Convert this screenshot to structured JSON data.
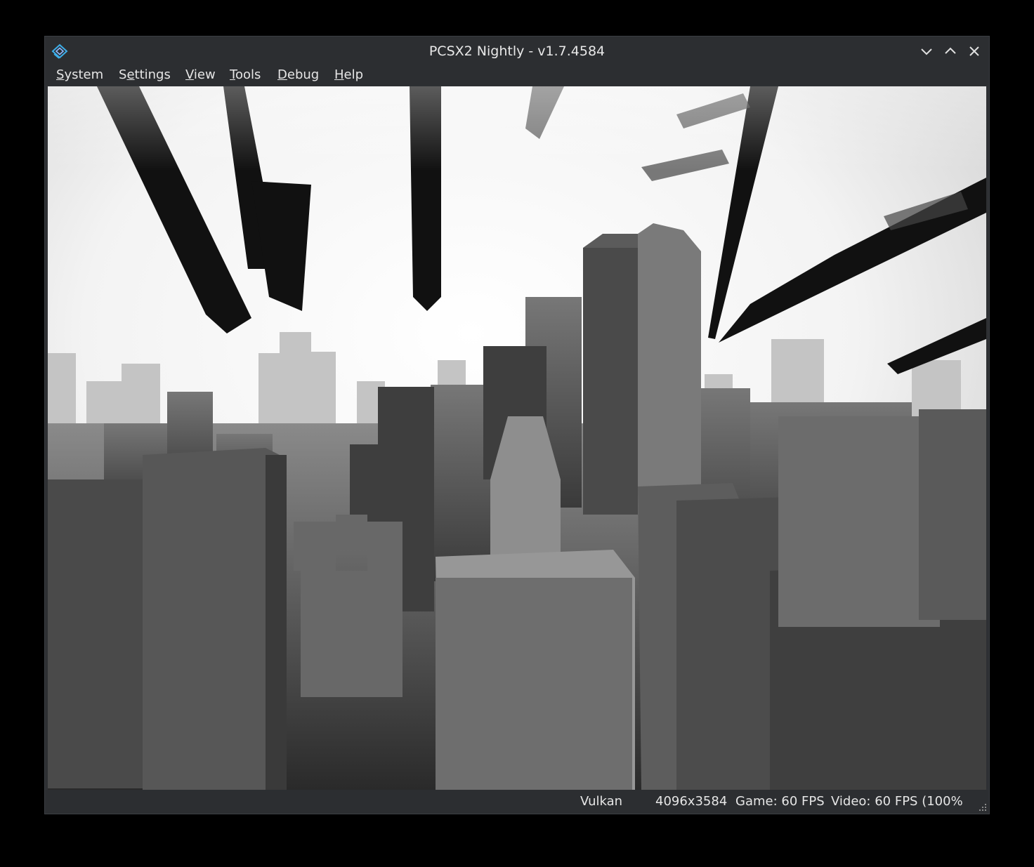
{
  "window": {
    "title": "PCSX2 Nightly - v1.7.4584",
    "app_icon": "pcsx2-logo-icon",
    "controls": {
      "minimize_icon": "chevron-down-icon",
      "maximize_icon": "chevron-up-icon",
      "close_icon": "close-icon"
    }
  },
  "menubar": {
    "items": [
      {
        "mnemonic": "S",
        "rest": "ystem"
      },
      {
        "pre": "S",
        "mnemonic": "e",
        "rest": "ttings"
      },
      {
        "mnemonic": "V",
        "rest": "iew"
      },
      {
        "mnemonic": "T",
        "rest": "ools"
      },
      {
        "mnemonic": "D",
        "rest": "ebug"
      },
      {
        "mnemonic": "H",
        "rest": "elp"
      }
    ]
  },
  "viewport": {
    "description_icon": "game-render-area"
  },
  "statusbar": {
    "renderer": "Vulkan",
    "resolution": "4096x3584",
    "game_fps": "Game: 60 FPS",
    "video_fps": "Video: 60 FPS (100%"
  },
  "colors": {
    "window_bg": "#2e3033",
    "text": "#e6e6e6",
    "accent": "#3daee9"
  }
}
